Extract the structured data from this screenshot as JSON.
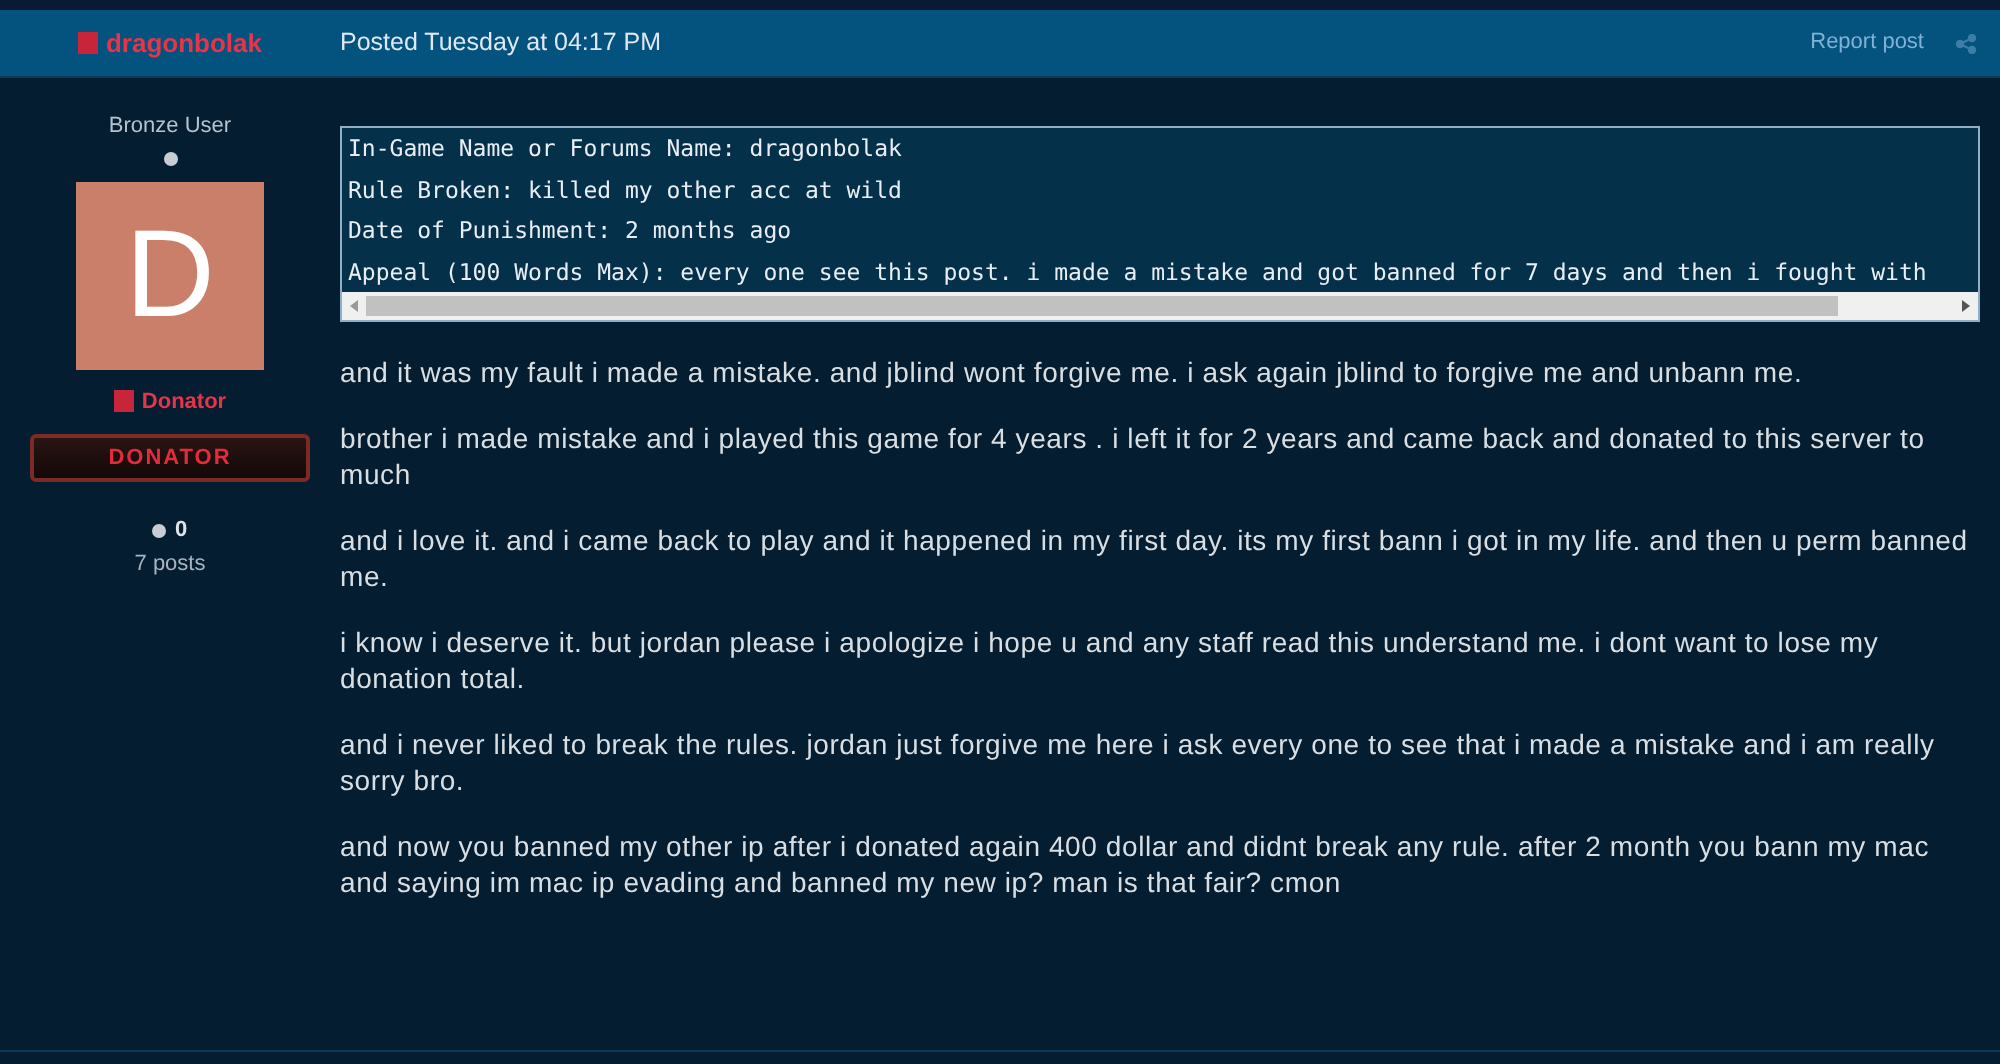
{
  "post_header": {
    "author": "dragonbolak",
    "posted": "Posted Tuesday at 04:17 PM",
    "report": "Report post"
  },
  "author_panel": {
    "rank": "Bronze User",
    "avatar_letter": "D",
    "group": "Donator",
    "badge": "DONATOR",
    "reputation": "0",
    "posts": "7 posts"
  },
  "code_block": {
    "lines": [
      "In-Game Name or Forums Name: dragonbolak",
      "Rule Broken: killed my other acc at wild",
      "Date of Punishment: 2 months ago",
      "Appeal (100 Words Max): every one see this post. i made a mistake and got banned for 7 days and then i fought with"
    ]
  },
  "paragraphs": [
    "and it was my fault i made a mistake. and jblind wont forgive me. i ask again jblind to forgive me and unbann me.",
    "brother i made mistake and i played this game for 4 years . i left it for 2 years and came back and donated to this server to much",
    "and i love it. and i came back to play and it happened in my first day. its my first bann i got in my life. and then u perm banned me.",
    "i know i deserve it. but jordan please i apologize i hope u and any staff read this understand me. i dont want to lose my donation total.",
    "and i never liked to break the rules. jordan just forgive me here i ask every one to see that i made a mistake and i am really sorry bro.",
    "and now you banned my other ip after i donated again 400 dollar and didnt break any rule. after 2 month you bann my mac and saying im mac ip evading and banned my new ip? man is that fair? cmon"
  ]
}
